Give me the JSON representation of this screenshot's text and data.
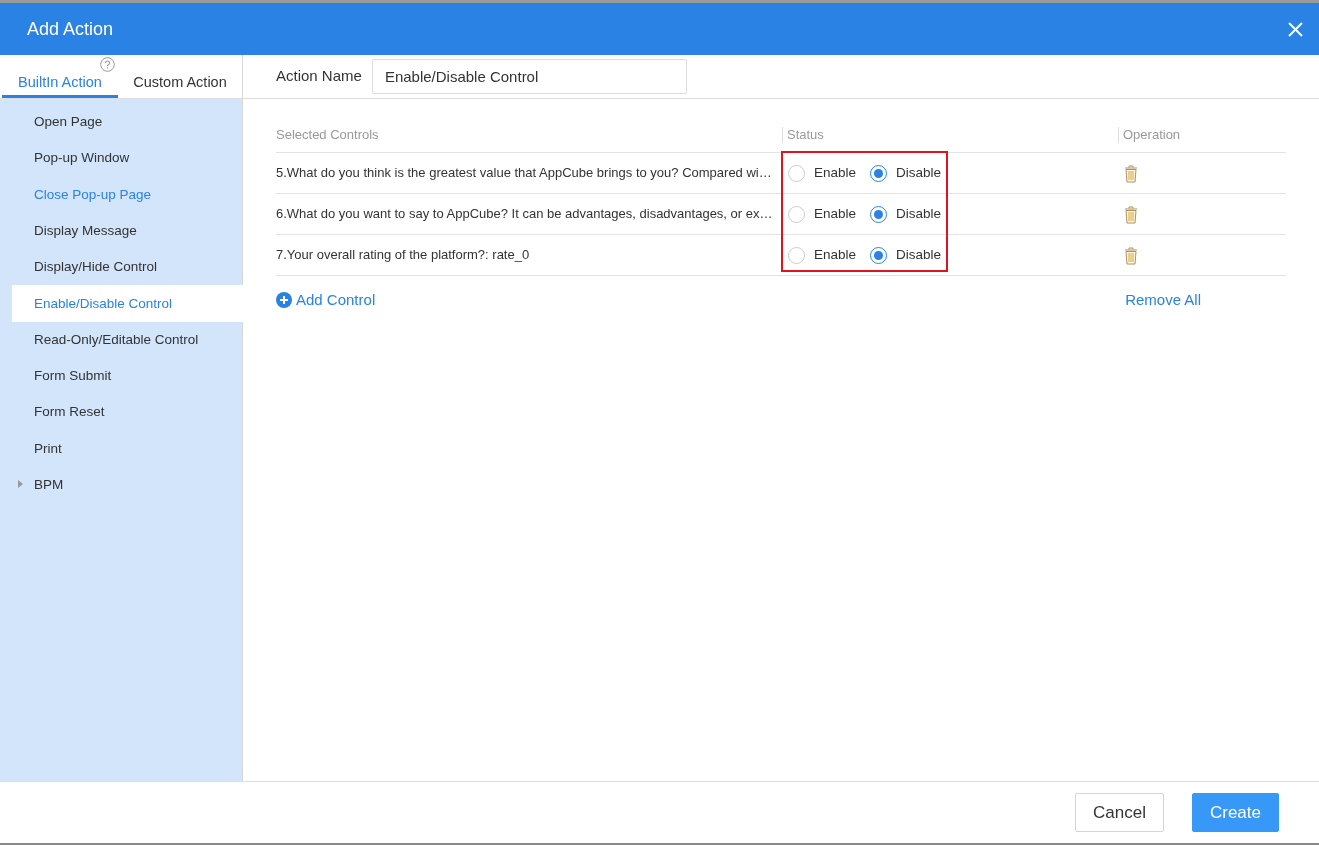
{
  "window": {
    "title": "Add Action"
  },
  "tabs": [
    {
      "label": "BuiltIn Action",
      "selected": true
    },
    {
      "label": "Custom Action",
      "selected": false
    }
  ],
  "sidebar": {
    "items": [
      {
        "label": "Open Page",
        "kind": "action",
        "selected": false,
        "hovered": false
      },
      {
        "label": "Pop-up Window",
        "kind": "action",
        "selected": false,
        "hovered": false
      },
      {
        "label": "Close Pop-up Page",
        "kind": "action",
        "selected": false,
        "hovered": true
      },
      {
        "label": "Display Message",
        "kind": "action",
        "selected": false,
        "hovered": false
      },
      {
        "label": "Display/Hide Control",
        "kind": "action",
        "selected": false,
        "hovered": false
      },
      {
        "label": "Enable/Disable Control",
        "kind": "action",
        "selected": true,
        "hovered": false
      },
      {
        "label": "Read-Only/Editable Control",
        "kind": "action",
        "selected": false,
        "hovered": false
      },
      {
        "label": "Form Submit",
        "kind": "action",
        "selected": false,
        "hovered": false
      },
      {
        "label": "Form Reset",
        "kind": "action",
        "selected": false,
        "hovered": false
      },
      {
        "label": "Print",
        "kind": "action",
        "selected": false,
        "hovered": false
      },
      {
        "label": "BPM",
        "kind": "group",
        "selected": false,
        "hovered": false,
        "expanded": false
      }
    ]
  },
  "action_name": {
    "label": "Action Name",
    "value": "Enable/Disable Control"
  },
  "table": {
    "columns": [
      "Selected Controls",
      "Status",
      "Operation"
    ],
    "status_highlighted": true,
    "rows": [
      {
        "control": "5.What do you think is the greatest value that AppCube brings to you? Compared wi…",
        "options": [
          {
            "label": "Enable",
            "selected": false
          },
          {
            "label": "Disable",
            "selected": true
          }
        ]
      },
      {
        "control": "6.What do you want to say to AppCube? It can be advantages, disadvantages, or ex…",
        "options": [
          {
            "label": "Enable",
            "selected": false
          },
          {
            "label": "Disable",
            "selected": true
          }
        ]
      },
      {
        "control": "7.Your overall rating of the platform?: rate_0",
        "options": [
          {
            "label": "Enable",
            "selected": false
          },
          {
            "label": "Disable",
            "selected": true
          }
        ]
      }
    ]
  },
  "add_control": "Add Control",
  "remove_all": "Remove All",
  "buttons": [
    {
      "label": "Cancel",
      "kind": "secondary"
    },
    {
      "label": "Create",
      "kind": "primary"
    }
  ]
}
